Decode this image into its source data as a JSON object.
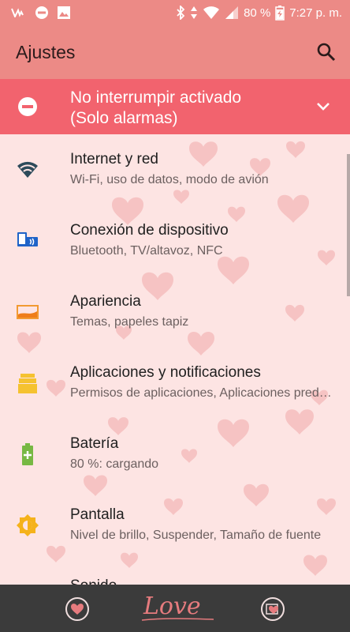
{
  "status_bar": {
    "battery_text": "80 %",
    "time": "7:27 p. m.",
    "icons": [
      "voicemail-icon",
      "dnd-status-icon",
      "image-icon",
      "bluetooth-icon",
      "data-arrows-icon",
      "wifi-icon",
      "signal-icon",
      "battery-charging-icon"
    ]
  },
  "appbar": {
    "title": "Ajustes",
    "search_icon": "search-icon"
  },
  "dnd_banner": {
    "line1": "No interrumpir activado",
    "line2": "(Solo alarmas)",
    "icon": "do-not-disturb-icon",
    "expand_icon": "chevron-down-icon",
    "color": "#f2636e"
  },
  "settings": [
    {
      "title": "Internet y red",
      "subtitle": "Wi-Fi, uso de datos, modo de avión",
      "icon": "wifi-icon"
    },
    {
      "title": "Conexión de dispositivo",
      "subtitle": "Bluetooth, TV/altavoz, NFC",
      "icon": "device-connection-icon"
    },
    {
      "title": "Apariencia",
      "subtitle": "Temas, papeles tapiz",
      "icon": "wallpaper-icon"
    },
    {
      "title": "Aplicaciones y notificaciones",
      "subtitle": "Permisos de aplicaciones, Aplicaciones predeterminadas",
      "icon": "apps-icon"
    },
    {
      "title": "Batería",
      "subtitle": "80 %: cargando",
      "icon": "battery-icon"
    },
    {
      "title": "Pantalla",
      "subtitle": "Nivel de brillo, Suspender, Tamaño de fuente",
      "icon": "brightness-icon"
    },
    {
      "title": "Sonido",
      "subtitle": "",
      "icon": "sound-icon"
    }
  ],
  "dock": {
    "brand_text": "Love",
    "left_icon": "heart-circle-icon",
    "right_icon": "heart-photo-icon"
  },
  "colors": {
    "header": "#ec8a86",
    "background": "#fde4e3",
    "dock": "#3b3b3b",
    "accent": "#e67b7e"
  }
}
